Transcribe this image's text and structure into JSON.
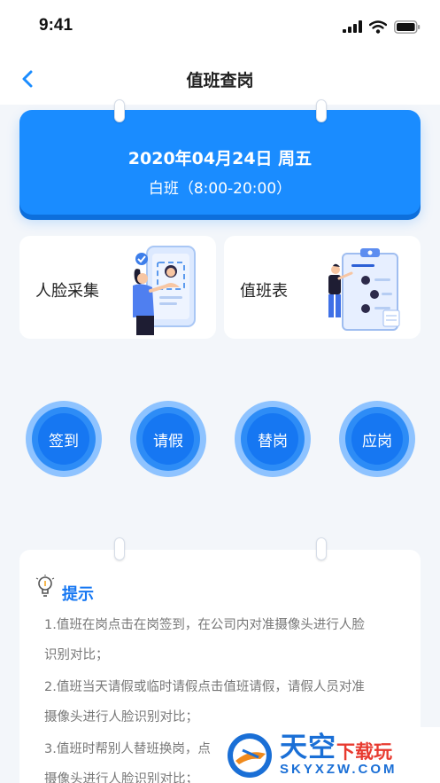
{
  "status_bar": {
    "time": "9:41"
  },
  "nav": {
    "title": "值班查岗"
  },
  "duty": {
    "date": "2020年04月24日 周五",
    "shift": "白班（8:00-20:00）"
  },
  "features": [
    {
      "label": "人脸采集"
    },
    {
      "label": "值班表"
    }
  ],
  "actions": [
    {
      "label": "签到"
    },
    {
      "label": "请假"
    },
    {
      "label": "替岗"
    },
    {
      "label": "应岗"
    }
  ],
  "tips": {
    "title": "提示",
    "items": [
      "1.值班在岗点击在岗签到，在公司内对准摄像头进行人脸",
      "识别对比；",
      "2.值班当天请假或临时请假点击值班请假，请假人员对准",
      "摄像头进行人脸识别对比；",
      "3.值班时帮别人替班换岗，点",
      "摄像头进行人脸识别对比；"
    ]
  },
  "watermark": {
    "main": "天空",
    "sub": "下载玩",
    "url": "SKYXZW.COM"
  },
  "colors": {
    "primary": "#1a8cff",
    "action": "#1677f2",
    "background": "#f3f6fa"
  }
}
